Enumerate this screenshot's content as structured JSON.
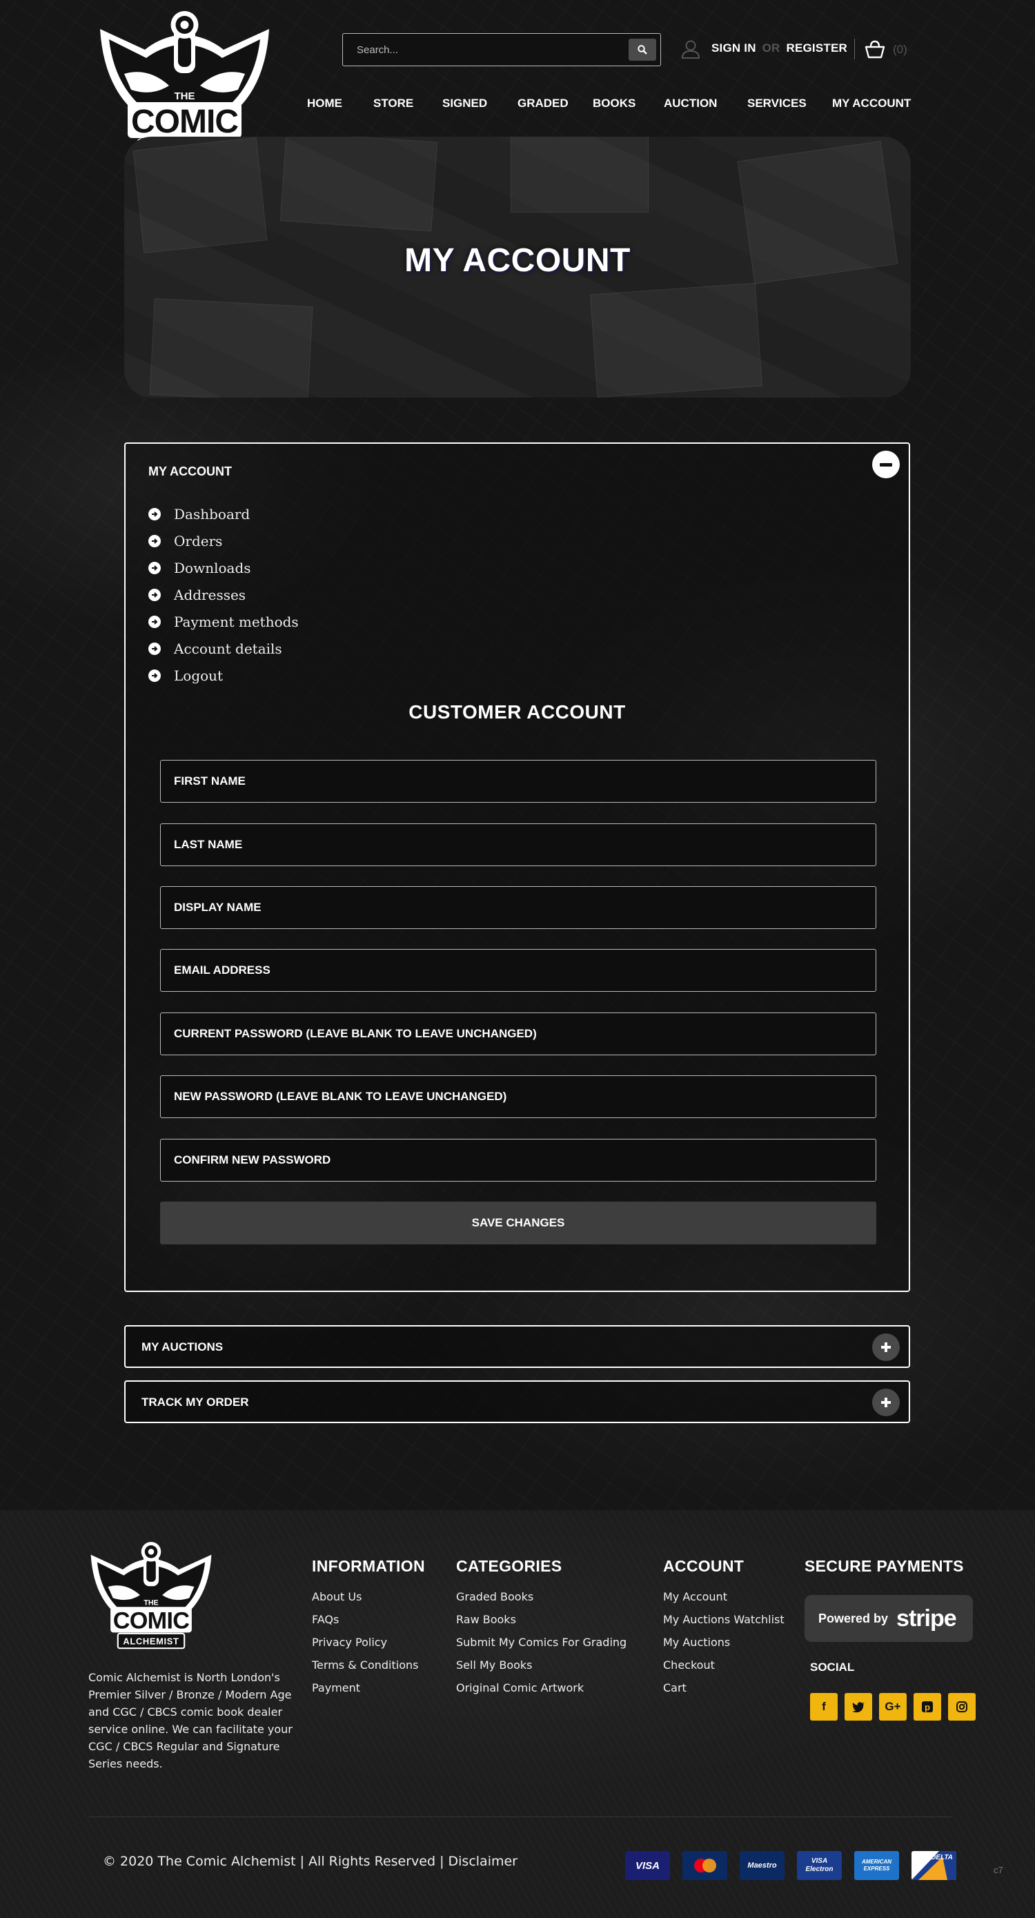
{
  "header": {
    "logo_alt": "THE COMIC ALCHEMIST",
    "search_placeholder": "Search...",
    "sign_in": "SIGN IN",
    "or": "OR",
    "register": "REGISTER",
    "cart_count": "(0)"
  },
  "nav": [
    "HOME",
    "STORE",
    "SIGNED",
    "GRADED",
    "BOOKS",
    "AUCTION",
    "SERVICES",
    "MY ACCOUNT"
  ],
  "banner": {
    "title": "MY ACCOUNT"
  },
  "account_panel": {
    "title": "MY ACCOUNT",
    "menu": [
      "Dashboard",
      "Orders",
      "Downloads",
      "Addresses",
      "Payment methods",
      "Account details",
      "Logout"
    ],
    "form_title": "CUSTOMER ACCOUNT",
    "fields": [
      "FIRST NAME",
      "LAST NAME",
      "DISPLAY NAME",
      "EMAIL ADDRESS",
      "CURRENT PASSWORD (LEAVE BLANK TO LEAVE UNCHANGED)",
      "NEW PASSWORD (LEAVE BLANK TO LEAVE UNCHANGED)",
      "CONFIRM NEW PASSWORD"
    ],
    "save_label": "SAVE CHANGES"
  },
  "collapsed_panels": [
    "MY AUCTIONS",
    "TRACK MY ORDER"
  ],
  "footer": {
    "about": "Comic Alchemist is North London's Premier Silver / Bronze / Modern Age and CGC / CBCS comic book dealer service online. We can facilitate your CGC / CBCS Regular and Signature Series needs.",
    "columns": [
      {
        "title": "INFORMATION",
        "links": [
          "About Us",
          "FAQs",
          "Privacy Policy",
          "Terms & Conditions",
          "Payment"
        ]
      },
      {
        "title": "CATEGORIES",
        "links": [
          "Graded Books",
          "Raw Books",
          "Submit My Comics For Grading",
          "Sell My Books",
          "Original Comic Artwork"
        ]
      },
      {
        "title": "ACCOUNT",
        "links": [
          "My Account",
          "My Auctions Watchlist",
          "My Auctions",
          "Checkout",
          "Cart"
        ]
      }
    ],
    "secure_title": "SECURE PAYMENTS",
    "stripe_powered": "Powered by",
    "stripe_name": "stripe",
    "social_title": "SOCIAL",
    "social_icons": [
      "facebook-icon",
      "twitter-icon",
      "google-plus-icon",
      "pinterest-icon",
      "instagram-icon"
    ],
    "copyright": "© 2020 The Comic Alchemist | All Rights Reserved | Disclaimer",
    "cards": [
      "VISA",
      "MasterCard",
      "Maestro",
      "VISA Electron",
      "AMERICAN EXPRESS",
      "DELTA"
    ],
    "version": "c7"
  },
  "colors": {
    "accent": "#f0b60f",
    "panel_border": "#ffffff",
    "button_bg": "#3e3e3e"
  }
}
